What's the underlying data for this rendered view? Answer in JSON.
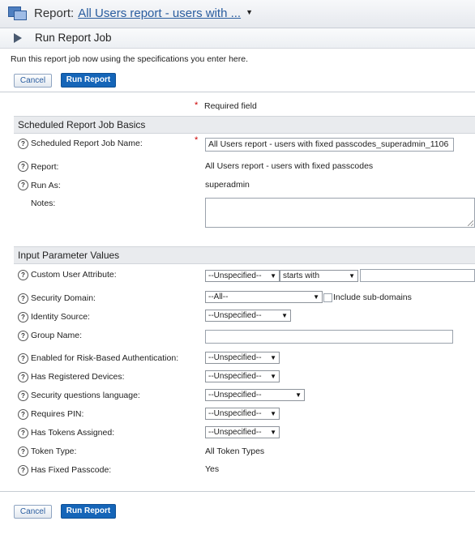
{
  "header": {
    "title_prefix": "Report:",
    "report_link": "All Users report - users with ...",
    "dropdown_caret": "▼",
    "app_icon": "report-windows-icon"
  },
  "job": {
    "title": "Run Report Job",
    "icon": "play-icon"
  },
  "intro": "Run this report job now using the specifications you enter here.",
  "buttons": {
    "cancel": "Cancel",
    "run": "Run Report"
  },
  "required": {
    "star": "*",
    "text": "Required field"
  },
  "help_glyph": "?",
  "basics": {
    "section_title": "Scheduled Report Job Basics",
    "job_name_label": "Scheduled Report Job Name:",
    "job_name_value": "All Users report - users with fixed passcodes_superadmin_1106",
    "report_label": "Report:",
    "report_value": "All Users report - users with fixed passcodes",
    "run_as_label": "Run As:",
    "run_as_value": "superadmin",
    "notes_label": "Notes:",
    "notes_value": ""
  },
  "params": {
    "section_title": "Input Parameter Values",
    "custom_attr_label": "Custom User Attribute:",
    "custom_attr_select": "--Unspecified--",
    "custom_attr_operator": "starts with",
    "custom_attr_value": "",
    "security_domain_label": "Security Domain:",
    "security_domain_select": "--All--",
    "include_subdomains_label": "Include sub-domains",
    "include_subdomains_checked": false,
    "identity_source_label": "Identity Source:",
    "identity_source_select": "--Unspecified--",
    "group_name_label": "Group Name:",
    "group_name_value": "",
    "rba_label": "Enabled for Risk-Based Authentication:",
    "rba_select": "--Unspecified--",
    "registered_devices_label": "Has Registered Devices:",
    "registered_devices_select": "--Unspecified--",
    "sq_language_label": "Security questions language:",
    "sq_language_select": "--Unspecified--",
    "requires_pin_label": "Requires PIN:",
    "requires_pin_select": "--Unspecified--",
    "tokens_assigned_label": "Has Tokens Assigned:",
    "tokens_assigned_select": "--Unspecified--",
    "token_type_label": "Token Type:",
    "token_type_value": "All Token Types",
    "fixed_passcode_label": "Has Fixed Passcode:",
    "fixed_passcode_value": "Yes"
  },
  "select_arrow": "▼"
}
